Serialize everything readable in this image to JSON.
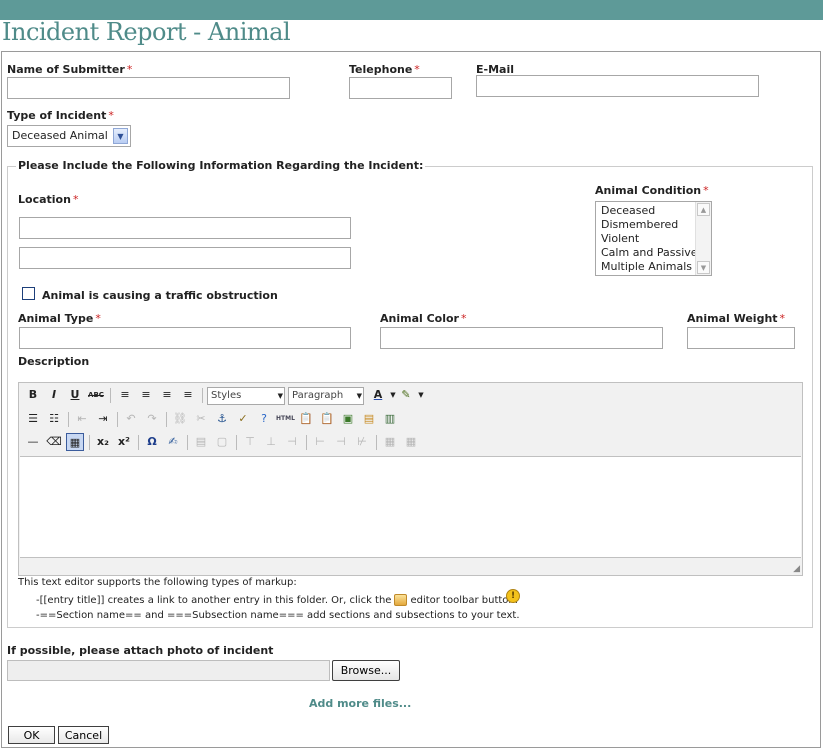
{
  "page": {
    "title": "Incident Report - Animal"
  },
  "form": {
    "submitter": {
      "label": "Name of Submitter",
      "value": ""
    },
    "telephone": {
      "label": "Telephone",
      "value": ""
    },
    "email": {
      "label": "E-Mail",
      "value": ""
    },
    "incident_type": {
      "label": "Type of Incident",
      "selected": "Deceased Animal"
    },
    "required_mark": "*",
    "details": {
      "legend": "Please Include the Following Information Regarding the Incident:",
      "location": {
        "label": "Location",
        "line1": "",
        "line2": ""
      },
      "animal_condition": {
        "label": "Animal Condition",
        "options": [
          "Deceased",
          "Dismembered",
          "Violent",
          "Calm and Passive",
          "Multiple Animals"
        ]
      },
      "traffic_checkbox": {
        "label": "Animal is causing a traffic obstruction",
        "checked": false
      },
      "animal_type": {
        "label": "Animal Type",
        "value": ""
      },
      "animal_color": {
        "label": "Animal Color",
        "value": ""
      },
      "animal_weight": {
        "label": "Animal Weight",
        "value": ""
      },
      "description": {
        "label": "Description",
        "value": ""
      }
    },
    "editor": {
      "styles_dropdown": "Styles",
      "format_dropdown": "Paragraph",
      "html_button": "HTML",
      "help": {
        "intro": "This text editor supports the following types of markup:",
        "line1_before": "-[[entry title]] creates a link to another entry in this folder. Or, click the",
        "line1_after": "editor toolbar button.",
        "line2": "-==Section name== and ===Subsection name=== add sections and subsections to your text."
      }
    },
    "attachment": {
      "label": "If possible, please attach photo of incident",
      "browse_label": "Browse...",
      "add_more": "Add more files..."
    },
    "buttons": {
      "ok": "OK",
      "cancel": "Cancel"
    }
  },
  "colors": {
    "header_bar": "#5e9a98",
    "title": "#4f8b89",
    "required": "#cc2222",
    "link": "#4f8b89"
  }
}
